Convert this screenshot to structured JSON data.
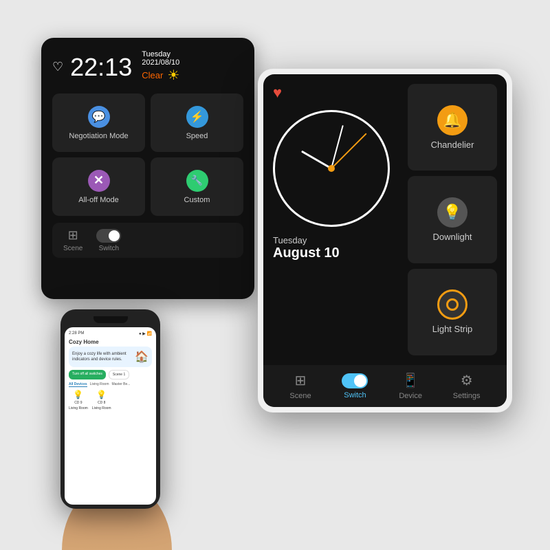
{
  "back_tablet": {
    "time": "22:13",
    "day": "Tuesday",
    "date": "2021/08/10",
    "weather": "Clear",
    "grid_items": [
      {
        "label": "Negotiation Mode",
        "icon": "💬",
        "type": "neg"
      },
      {
        "label": "Speed",
        "icon": "⚡",
        "type": "speed"
      },
      {
        "label": "All-off Mode",
        "icon": "✕",
        "type": "alloff"
      },
      {
        "label": "Custom",
        "icon": "🔧",
        "type": "custom"
      }
    ],
    "nav_items": [
      {
        "label": "Scene",
        "icon": "⊞"
      },
      {
        "label": "Switch",
        "icon": "toggle"
      }
    ]
  },
  "front_tablet": {
    "heart": "♥",
    "clock": {
      "day": "Tuesday",
      "date": "August 10"
    },
    "devices": [
      {
        "label": "Chandelier",
        "icon": "🔔",
        "type": "chandelier"
      },
      {
        "label": "Downlight",
        "icon": "💡",
        "type": "downlight"
      },
      {
        "label": "Light Strip",
        "icon": "○",
        "type": "lightstrip"
      }
    ],
    "nav": [
      {
        "label": "Scene",
        "icon": "⊞",
        "active": false
      },
      {
        "label": "Switch",
        "icon": "toggle",
        "active": true
      },
      {
        "label": "Device",
        "icon": "📱",
        "active": false
      },
      {
        "label": "Settings",
        "icon": "⚙",
        "active": false
      }
    ]
  },
  "phone": {
    "time": "2:28 PM",
    "app_name": "Cozy Home",
    "tagline": "Enjoy a cozy life with ambient indicators and device rules.",
    "buttons": [
      "Turn off all switches",
      "Scene 1"
    ],
    "tabs": [
      "All Devices",
      "Living Room",
      "Master Be..."
    ],
    "devices": [
      {
        "name": "CD 9",
        "room": "Living Room"
      },
      {
        "name": "CD 8",
        "room": "Living Room"
      }
    ]
  }
}
